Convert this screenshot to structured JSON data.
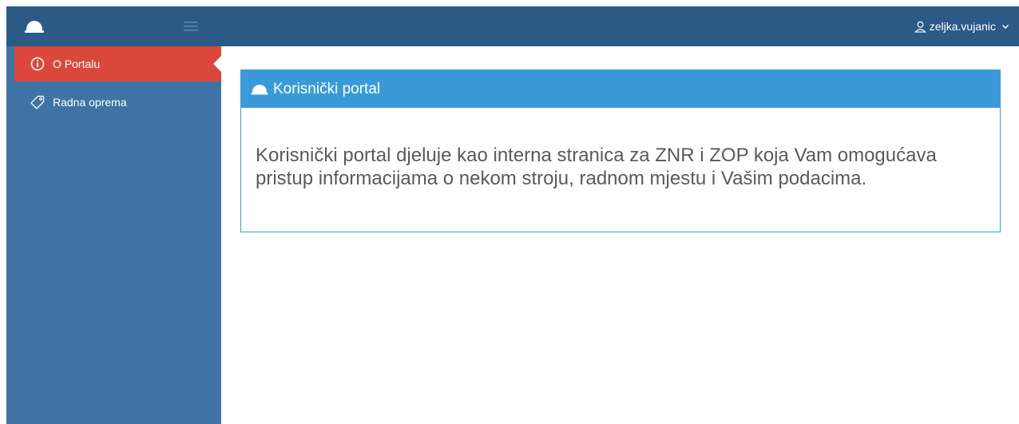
{
  "topbar": {
    "logo_icon": "helmet-icon",
    "menu_toggle_icon": "hamburger-icon",
    "user": {
      "icon": "user-icon",
      "username": "zeljka.vujanic",
      "caret_icon": "chevron-down-icon"
    }
  },
  "sidebar": {
    "items": [
      {
        "label": "O Portalu",
        "icon": "info-circle-icon",
        "active": true
      },
      {
        "label": "Radna oprema",
        "icon": "tag-icon",
        "active": false
      }
    ]
  },
  "panel": {
    "icon": "helmet-icon",
    "title": "Korisnički portal",
    "body": "Korisnički portal djeluje kao interna stranica za ZNR i ZOP koja Vam omogućava pristup informacijama o nekom stroju, radnom mjestu i Vašim podacima."
  },
  "colors": {
    "topbar": "#2b5a87",
    "sidebar": "#3e73a4",
    "active_item": "#d9483b",
    "panel_accent": "#3a9ad9",
    "body_text": "#5a5a5a"
  }
}
